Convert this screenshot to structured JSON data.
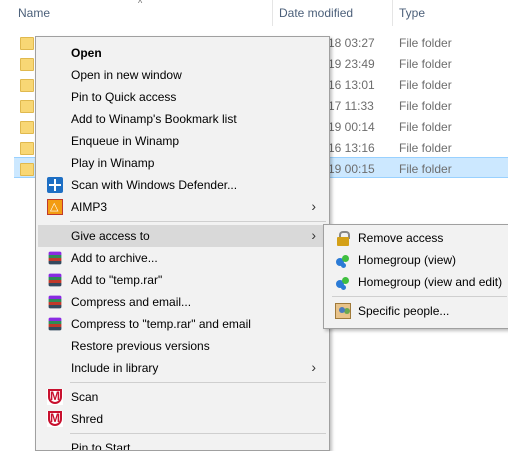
{
  "header": {
    "columns": [
      "Name",
      "Date modified",
      "Type"
    ],
    "sort_indicator": "^"
  },
  "rows": [
    {
      "date": "18 03:27",
      "type": "File folder",
      "selected": false
    },
    {
      "date": "19 23:49",
      "type": "File folder",
      "selected": false
    },
    {
      "date": "16 13:01",
      "type": "File folder",
      "selected": false
    },
    {
      "date": "17 11:33",
      "type": "File folder",
      "selected": false
    },
    {
      "date": "19 00:14",
      "type": "File folder",
      "selected": false
    },
    {
      "date": "16 13:16",
      "type": "File folder",
      "selected": false
    },
    {
      "date": "19 00:15",
      "type": "File folder",
      "selected": true
    }
  ],
  "context_menu": {
    "items": [
      {
        "label": "Open",
        "bold": true,
        "icon": ""
      },
      {
        "label": "Open in new window",
        "icon": ""
      },
      {
        "label": "Pin to Quick access",
        "icon": ""
      },
      {
        "label": "Add to Winamp's Bookmark list",
        "icon": ""
      },
      {
        "label": "Enqueue in Winamp",
        "icon": ""
      },
      {
        "label": "Play in Winamp",
        "icon": ""
      },
      {
        "label": "Scan with Windows Defender...",
        "icon": "defender-icon"
      },
      {
        "label": "AIMP3",
        "icon": "aimp-icon",
        "submenu": true
      },
      {
        "label": "Give access to",
        "icon": "",
        "submenu": true,
        "highlighted": true
      },
      {
        "label": "Add to archive...",
        "icon": "winrar-icon"
      },
      {
        "label": "Add to \"temp.rar\"",
        "icon": "winrar-icon"
      },
      {
        "label": "Compress and email...",
        "icon": "winrar-icon"
      },
      {
        "label": "Compress to \"temp.rar\" and email",
        "icon": "winrar-icon"
      },
      {
        "label": "Restore previous versions",
        "icon": ""
      },
      {
        "label": "Include in library",
        "icon": "",
        "submenu": true
      },
      {
        "label": "Scan",
        "icon": "mcafee-icon"
      },
      {
        "label": "Shred",
        "icon": "mcafee-icon"
      },
      {
        "label": "Pin to Start",
        "icon": ""
      }
    ],
    "submenu_arrow": "›"
  },
  "give_access_submenu": {
    "items": [
      {
        "label": "Remove access",
        "icon": "lock-icon"
      },
      {
        "label": "Homegroup (view)",
        "icon": "homegroup-icon"
      },
      {
        "label": "Homegroup (view and edit)",
        "icon": "homegroup-icon"
      },
      {
        "label": "Specific people...",
        "icon": "people-icon"
      }
    ]
  }
}
